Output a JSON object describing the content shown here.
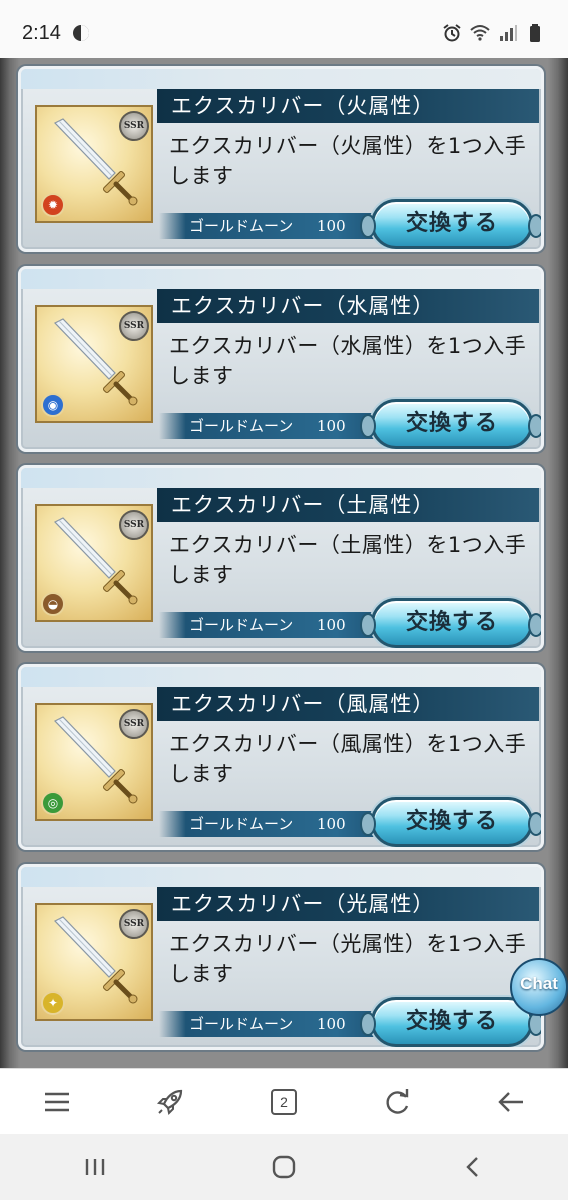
{
  "status_bar": {
    "time": "2:14"
  },
  "items": [
    {
      "title": "エクスカリバー（火属性）",
      "desc": "エクスカリバー（火属性）を1つ入手します",
      "rarity": "SSR",
      "element": "fire",
      "element_color": "#d2431f",
      "cost_label": "ゴールドムーン",
      "cost_value": "100",
      "button_label": "交換する"
    },
    {
      "title": "エクスカリバー（水属性）",
      "desc": "エクスカリバー（水属性）を1つ入手します",
      "rarity": "SSR",
      "element": "water",
      "element_color": "#2d6fd1",
      "cost_label": "ゴールドムーン",
      "cost_value": "100",
      "button_label": "交換する"
    },
    {
      "title": "エクスカリバー（土属性）",
      "desc": "エクスカリバー（土属性）を1つ入手します",
      "rarity": "SSR",
      "element": "earth",
      "element_color": "#8a5a2b",
      "cost_label": "ゴールドムーン",
      "cost_value": "100",
      "button_label": "交換する"
    },
    {
      "title": "エクスカリバー（風属性）",
      "desc": "エクスカリバー（風属性）を1つ入手します",
      "rarity": "SSR",
      "element": "wind",
      "element_color": "#3a9a3a",
      "cost_label": "ゴールドムーン",
      "cost_value": "100",
      "button_label": "交換する"
    },
    {
      "title": "エクスカリバー（光属性）",
      "desc": "エクスカリバー（光属性）を1つ入手します",
      "rarity": "SSR",
      "element": "light",
      "element_color": "#d8b42a",
      "cost_label": "ゴールドムーン",
      "cost_value": "100",
      "button_label": "交換する"
    }
  ],
  "chat_button": {
    "label": "Chat"
  },
  "browser_toolbar": {
    "tab_count": "2"
  },
  "icons": {
    "status": [
      "data-saver-icon",
      "alarm-icon",
      "wifi-icon",
      "signal-icon",
      "battery-icon"
    ],
    "toolbar": [
      "menu-icon",
      "rocket-icon",
      "tabs-icon",
      "refresh-icon",
      "back-arrow-icon"
    ],
    "nav": [
      "recent-apps-icon",
      "home-icon",
      "back-icon"
    ]
  }
}
